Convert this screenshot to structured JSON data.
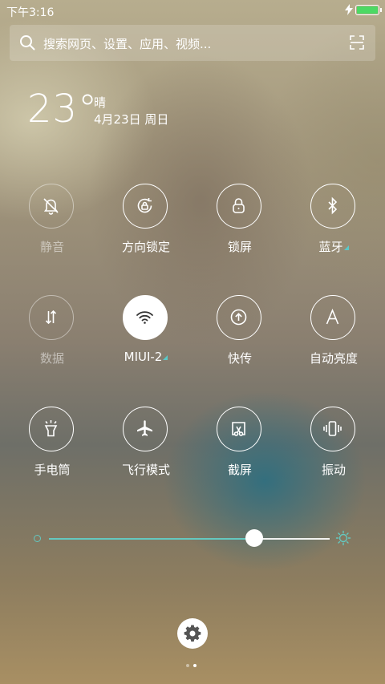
{
  "status_bar": {
    "time": "下午3:16",
    "battery_color": "#4cd964",
    "icons": [
      "charging-icon",
      "battery-icon"
    ]
  },
  "search": {
    "placeholder": "搜索网页、设置、应用、视频...",
    "icons": [
      "search-icon",
      "scan-icon"
    ]
  },
  "weather": {
    "temperature": "23°",
    "condition": "晴",
    "date": "4月23日 周日"
  },
  "toggles": [
    {
      "label": "静音",
      "icon": "mute-bell-icon",
      "state": "disabled"
    },
    {
      "label": "方向锁定",
      "icon": "rotation-lock-icon",
      "state": "off"
    },
    {
      "label": "锁屏",
      "icon": "lock-icon",
      "state": "off"
    },
    {
      "label": "蓝牙",
      "icon": "bluetooth-icon",
      "state": "off",
      "has_more": true
    },
    {
      "label": "数据",
      "icon": "mobile-data-icon",
      "state": "disabled"
    },
    {
      "label": "MIUI-2",
      "icon": "wifi-icon",
      "state": "on",
      "has_more": true
    },
    {
      "label": "快传",
      "icon": "quick-transfer-icon",
      "state": "off"
    },
    {
      "label": "自动亮度",
      "icon": "auto-brightness-icon",
      "state": "off"
    },
    {
      "label": "手电筒",
      "icon": "flashlight-icon",
      "state": "off"
    },
    {
      "label": "飞行模式",
      "icon": "airplane-icon",
      "state": "off"
    },
    {
      "label": "截屏",
      "icon": "screenshot-icon",
      "state": "off"
    },
    {
      "label": "振动",
      "icon": "vibrate-icon",
      "state": "off"
    }
  ],
  "brightness": {
    "level": 0.73,
    "accent": "#64c8c0",
    "icons": [
      "brightness-low-icon",
      "brightness-high-icon"
    ]
  },
  "footer": {
    "settings_icon": "gear-icon",
    "page_count": 2,
    "current_page": 2
  }
}
